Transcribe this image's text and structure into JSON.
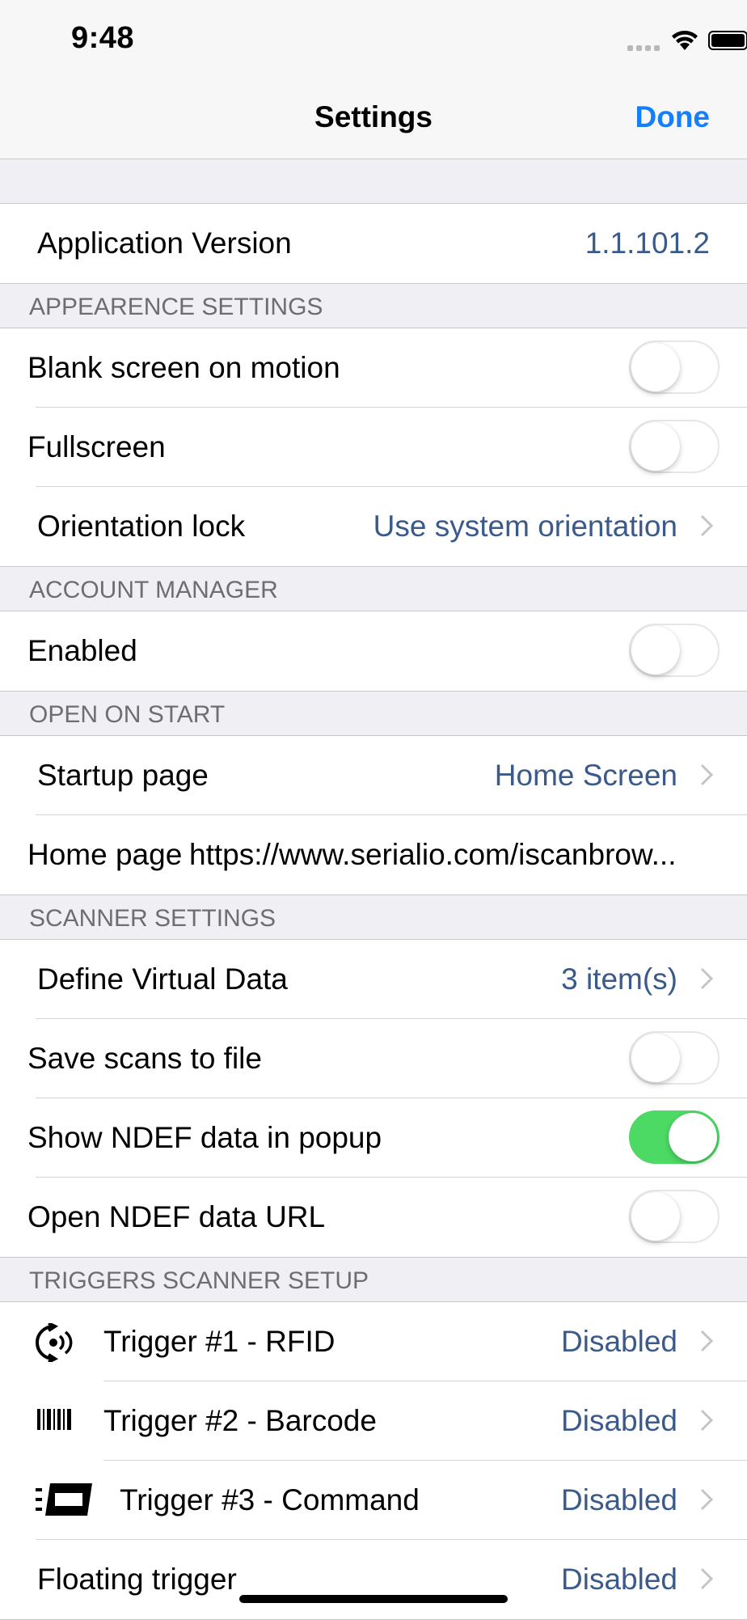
{
  "status": {
    "time": "9:48"
  },
  "nav": {
    "title": "Settings",
    "done_label": "Done"
  },
  "app_version": {
    "label": "Application Version",
    "value": "1.1.101.2"
  },
  "appearance": {
    "header": "APPEARENCE SETTINGS",
    "blank_screen": {
      "label": "Blank screen on motion",
      "on": false
    },
    "fullscreen": {
      "label": "Fullscreen",
      "on": false
    },
    "orientation": {
      "label": "Orientation lock",
      "value": "Use system orientation"
    }
  },
  "account": {
    "header": "ACCOUNT MANAGER",
    "enabled": {
      "label": "Enabled",
      "on": false
    }
  },
  "open_on_start": {
    "header": "OPEN ON START",
    "startup": {
      "label": "Startup page",
      "value": "Home Screen"
    },
    "home": {
      "label": "Home page",
      "value": "https://www.serialio.com/iscanbrow..."
    }
  },
  "scanner": {
    "header": "SCANNER SETTINGS",
    "virtual_data": {
      "label": "Define Virtual Data",
      "value": "3 item(s)"
    },
    "save_scans": {
      "label": "Save scans to file",
      "on": false
    },
    "show_ndef": {
      "label": "Show NDEF data in popup",
      "on": true
    },
    "open_ndef": {
      "label": "Open NDEF data URL",
      "on": false
    }
  },
  "triggers": {
    "header": "TRIGGERS SCANNER SETUP",
    "t1": {
      "label": "Trigger #1 - RFID",
      "value": "Disabled",
      "icon": "rfid-icon"
    },
    "t2": {
      "label": "Trigger #2 - Barcode",
      "value": "Disabled",
      "icon": "barcode-icon"
    },
    "t3": {
      "label": "Trigger #3 - Command",
      "value": "Disabled",
      "icon": "command-icon"
    },
    "floating": {
      "label": "Floating trigger",
      "value": "Disabled"
    }
  },
  "colors": {
    "accent": "#147efb",
    "value_text": "#3b5a8c",
    "toggle_on": "#4cd964",
    "background": "#efeff4"
  }
}
